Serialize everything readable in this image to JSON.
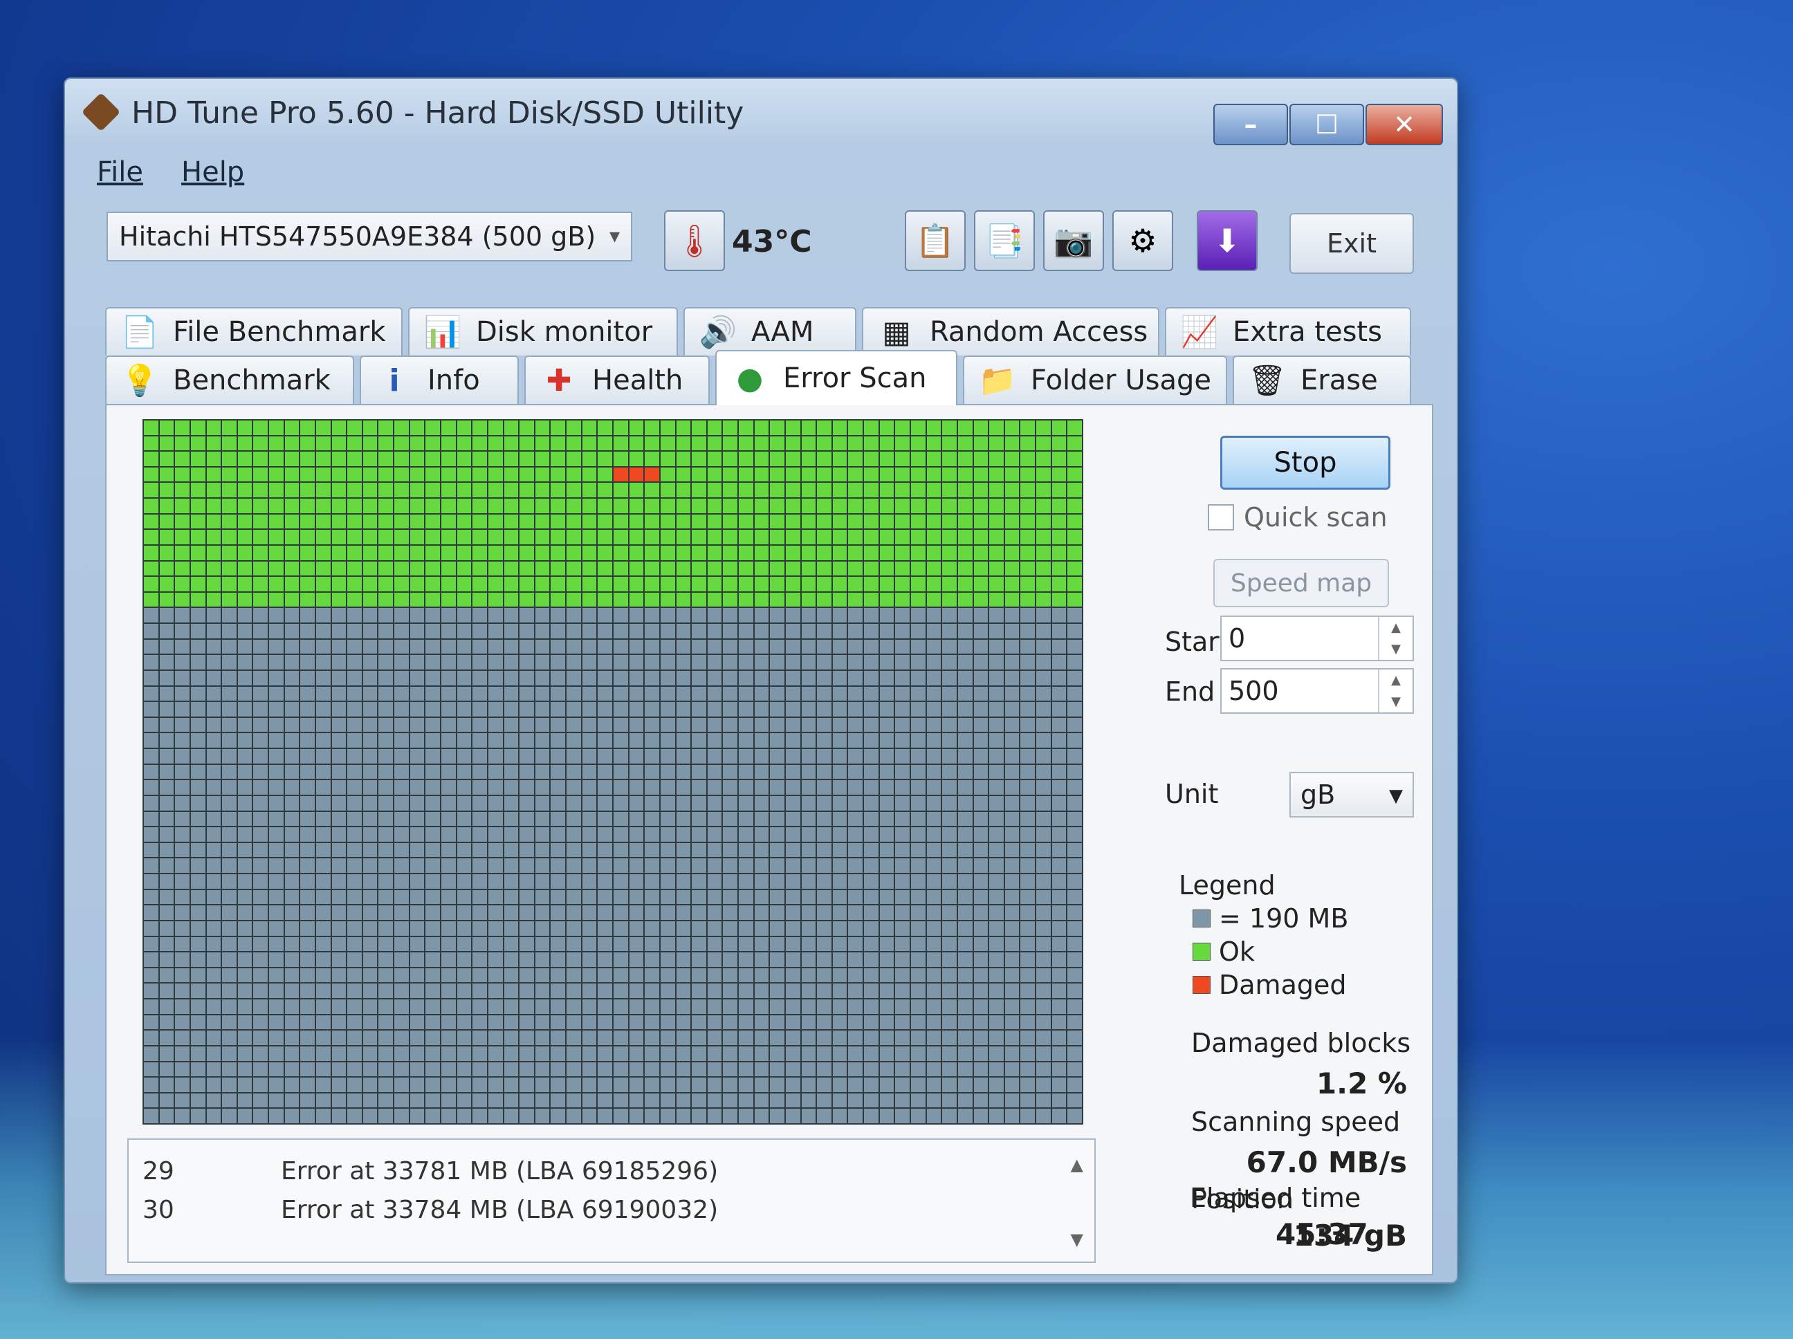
{
  "window": {
    "title": "HD Tune Pro 5.60 - Hard Disk/SSD Utility",
    "min_symbol": "–",
    "max_symbol": "☐",
    "close_symbol": "✕"
  },
  "menu": {
    "items": [
      "File",
      "Help"
    ]
  },
  "toolbar": {
    "drive": "Hitachi HTS547550A9E384 (500 gB)",
    "temperature": "43°C",
    "exit_label": "Exit",
    "icons": [
      "thermometer-icon",
      "copy-icon",
      "copy-all-icon",
      "screenshot-icon",
      "options-icon",
      "download-icon"
    ]
  },
  "tabs": {
    "row1": [
      "File Benchmark",
      "Disk monitor",
      "AAM",
      "Random Access",
      "Extra tests"
    ],
    "row2": [
      "Benchmark",
      "Info",
      "Health",
      "Error Scan",
      "Folder Usage",
      "Erase"
    ],
    "active": "Error Scan"
  },
  "scan": {
    "grid_cols": 60,
    "grid_rows": 45,
    "ok_rows": 12,
    "damaged_blocks_row": 3,
    "damaged_blocks_cols": [
      30,
      31,
      32
    ],
    "colors": {
      "unscanned": "#7f96a8",
      "ok": "#65d93d",
      "damaged": "#ef4a22"
    }
  },
  "log": {
    "entries": [
      {
        "index": "29",
        "text": "Error at 33781 MB (LBA 69185296)"
      },
      {
        "index": "30",
        "text": "Error at 33784 MB (LBA 69190032)"
      }
    ]
  },
  "controls": {
    "stop_label": "Stop",
    "quick_scan_label": "Quick scan",
    "speed_map_label": "Speed map",
    "start_label": "Start",
    "start_value": "0",
    "end_label": "End",
    "end_value": "500",
    "unit_label": "Unit",
    "unit_value": "gB"
  },
  "legend": {
    "title": "Legend",
    "block_size": "= 190 MB",
    "ok": "Ok",
    "damaged": "Damaged"
  },
  "stats": {
    "damaged_blocks_label": "Damaged blocks",
    "damaged_blocks_value": "1.2 %",
    "scanning_speed_label": "Scanning speed",
    "scanning_speed_value": "67.0 MB/s",
    "position_label": "Position",
    "position_value": "134 gB",
    "elapsed_label": "Elapsed time",
    "elapsed_value": "45:37"
  }
}
